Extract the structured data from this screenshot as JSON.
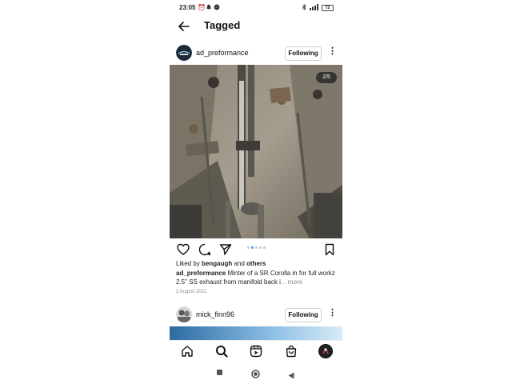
{
  "status_bar": {
    "time": "23:05",
    "battery": "72"
  },
  "header": {
    "title": "Tagged"
  },
  "post1": {
    "username": "ad_preformance",
    "follow_label": "Following",
    "counter": "2/5",
    "pager": {
      "total": 5,
      "active_index": 1
    },
    "liked_prefix": "Liked by ",
    "liked_user": "bengaugh",
    "liked_and": " and ",
    "liked_others": "others",
    "caption_user": "ad_preformance",
    "caption_text": " Minter of a SR Corolla in for full workz 2.5\" SS exhaust from manifold back i",
    "caption_more": "... more",
    "date": "2 August 2021"
  },
  "post2": {
    "username": "mick_finn96",
    "follow_label": "Following"
  },
  "icons": {
    "back": "arrow-left-icon",
    "like": "heart-icon",
    "comment": "comment-icon",
    "share": "send-icon",
    "save": "bookmark-icon",
    "home": "home-icon",
    "search": "search-icon",
    "reels": "reels-icon",
    "shop": "shop-icon",
    "profile": "profile-avatar"
  },
  "colors": {
    "accent": "#3897f0",
    "text": "#111111",
    "muted": "#8a8a8a"
  }
}
